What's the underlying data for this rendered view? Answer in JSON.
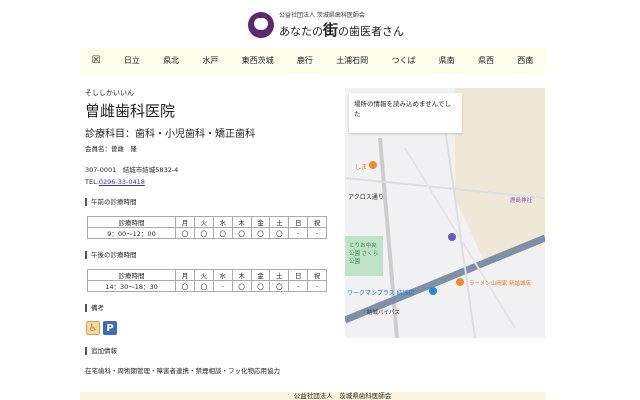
{
  "header": {
    "org": "公益社団法人 茨城県歯科医師会",
    "tagline_pre": "あなたの",
    "tagline_bold": "街",
    "tagline_post": "の歯医者さん"
  },
  "nav": [
    "日立",
    "県北",
    "水戸",
    "東西茨城",
    "鹿行",
    "土浦石岡",
    "つくば",
    "県南",
    "県西",
    "西南"
  ],
  "clinic": {
    "kana": "そししかいいん",
    "name": "曽雌歯科医院",
    "departments": "診療科目：歯科・小児歯科・矯正歯科",
    "member": "会員名：曽雌　隆",
    "address": "307-0001　結城市結城5832-4",
    "tel_label": "TEL:",
    "tel": "0296-33-0418"
  },
  "morning": {
    "heading": "午前の診療時間",
    "header": [
      "診療時間",
      "月",
      "火",
      "水",
      "木",
      "金",
      "土",
      "日",
      "祝"
    ],
    "row": [
      "9：00〜12：00",
      "〇",
      "〇",
      "〇",
      "〇",
      "〇",
      "〇",
      "-",
      "-"
    ]
  },
  "afternoon": {
    "heading": "午後の診療時間",
    "header": [
      "診療時間",
      "月",
      "火",
      "水",
      "木",
      "金",
      "土",
      "日",
      "祝"
    ],
    "row": [
      "14：30〜18：30",
      "〇",
      "〇",
      "-",
      "〇",
      "〇",
      "〇",
      "-",
      "-"
    ]
  },
  "remarks": {
    "heading": "備考",
    "icons": [
      "wheelchair-icon",
      "parking-icon"
    ],
    "parking_label": "P"
  },
  "extra": {
    "heading": "追加情報",
    "text": "在宅歯科・周術期管理・障害者連携・禁煙相談・フッ化物応用協力"
  },
  "map": {
    "error": "場所の情報を読み込めませんでした",
    "labels": [
      "しま",
      "アクロス通り",
      "鹿島神社",
      "とりお中央公園 さくら公園",
      "ワークマンプラス 結城店",
      "ラーメン山岡家 新結城店",
      "結城バイパス"
    ]
  },
  "footer": {
    "text": "公益社団法人　茨城県歯科医師会"
  }
}
